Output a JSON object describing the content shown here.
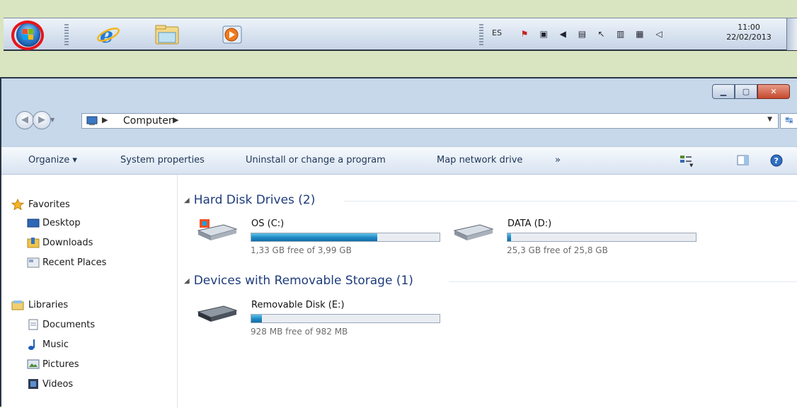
{
  "taskbar": {
    "language": "ES",
    "clock_time": "11:00",
    "clock_date": "22/02/2013",
    "apps": [
      "internet-explorer",
      "windows-explorer",
      "media-player"
    ]
  },
  "window": {
    "address": {
      "crumb": "Computer"
    },
    "toolbar": {
      "organize": "Organize ▾",
      "system_properties": "System properties",
      "uninstall": "Uninstall or change a program",
      "map_drive": "Map network drive",
      "more": "»"
    },
    "nav": {
      "favorites": "Favorites",
      "desktop": "Desktop",
      "downloads": "Downloads",
      "recent": "Recent Places",
      "libraries": "Libraries",
      "documents": "Documents",
      "music": "Music",
      "pictures": "Pictures",
      "videos": "Videos"
    },
    "groups": {
      "hdd": "Hard Disk Drives (2)",
      "removable": "Devices with Removable Storage (1)"
    },
    "drives": [
      {
        "name": "OS (C:)",
        "free": "1,33 GB free of 3,99 GB",
        "used_fraction": 0.67
      },
      {
        "name": "DATA (D:)",
        "free": "25,3 GB free of 25,8 GB",
        "used_fraction": 0.02
      },
      {
        "name": "Removable Disk (E:)",
        "free": "928 MB free of 982 MB",
        "used_fraction": 0.055
      }
    ]
  },
  "colors": {
    "accent_bar": "#1e88c5",
    "highlight_circle": "#e8141b"
  }
}
